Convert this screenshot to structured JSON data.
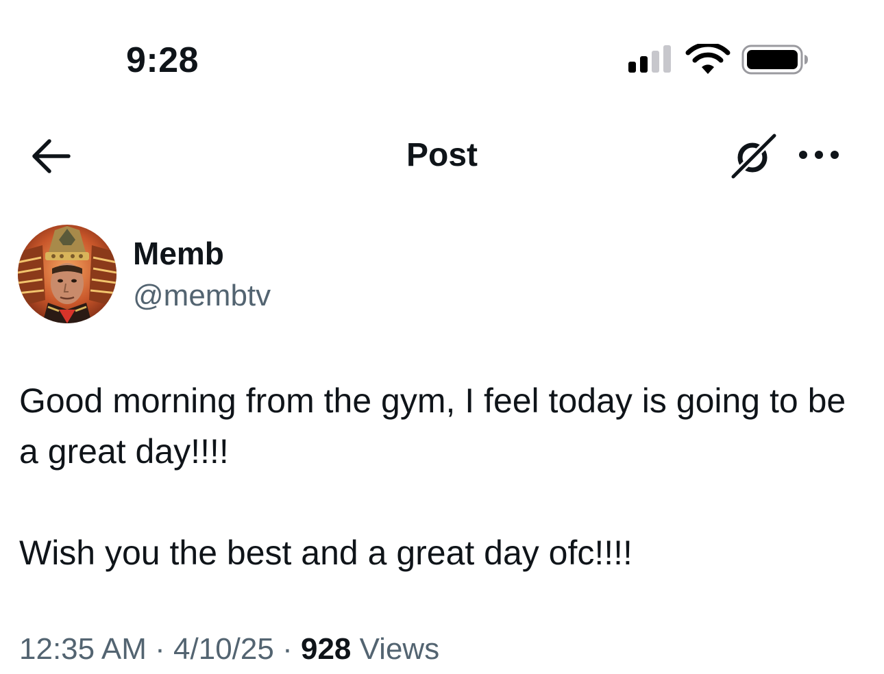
{
  "status_bar": {
    "time": "9:28",
    "signal_icon": "cellular-signal-icon",
    "wifi_icon": "wifi-icon",
    "battery_icon": "battery-icon"
  },
  "header": {
    "title": "Post",
    "back_icon": "arrow-left-icon",
    "grok_icon": "grok-icon",
    "more_icon": "more-horizontal-icon"
  },
  "author": {
    "display_name": "Memb",
    "handle": "@membtv"
  },
  "post": {
    "paragraphs": [
      "Good morning from the gym, I feel today is going to be a great day!!!!",
      "Wish you the best and a great day ofc!!!!"
    ],
    "time": "12:35 AM",
    "separator": "·",
    "date": "4/10/25",
    "views_count": "928",
    "views_label": "Views"
  }
}
